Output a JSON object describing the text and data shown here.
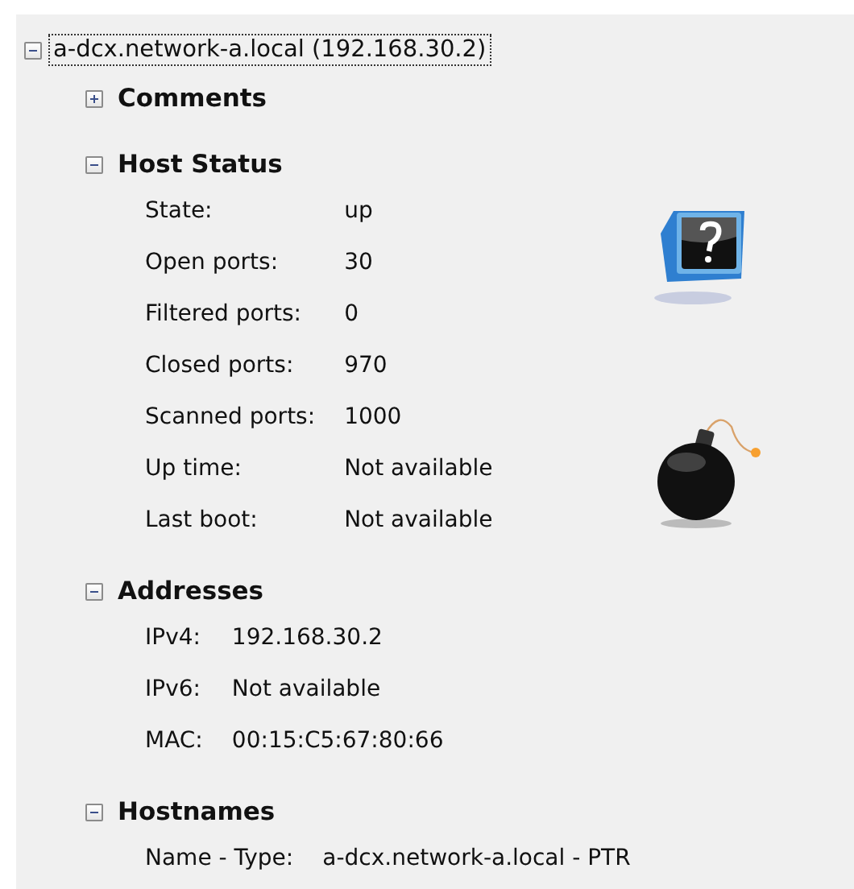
{
  "root": {
    "label": "a-dcx.network-a.local (192.168.30.2)",
    "expanded": true,
    "focused": true
  },
  "sections": [
    {
      "title": "Comments",
      "expanded": false
    },
    {
      "title": "Host Status",
      "expanded": true,
      "kind": "status",
      "rows": [
        {
          "label": "State:",
          "value": "up"
        },
        {
          "label": "Open ports:",
          "value": "30"
        },
        {
          "label": "Filtered ports:",
          "value": "0"
        },
        {
          "label": "Closed ports:",
          "value": "970"
        },
        {
          "label": "Scanned ports:",
          "value": "1000"
        },
        {
          "label": "Up time:",
          "value": "Not available"
        },
        {
          "label": "Last boot:",
          "value": "Not available"
        }
      ]
    },
    {
      "title": "Addresses",
      "expanded": true,
      "kind": "plain",
      "rows": [
        {
          "label": "IPv4:",
          "value": "192.168.30.2"
        },
        {
          "label": "IPv6:",
          "value": "Not available"
        },
        {
          "label": "MAC:",
          "value": "00:15:C5:67:80:66"
        }
      ]
    },
    {
      "title": "Hostnames",
      "expanded": true,
      "kind": "plain",
      "rows": [
        {
          "label": "Name - Type:",
          "value": "a-dcx.network-a.local - PTR"
        }
      ]
    }
  ]
}
